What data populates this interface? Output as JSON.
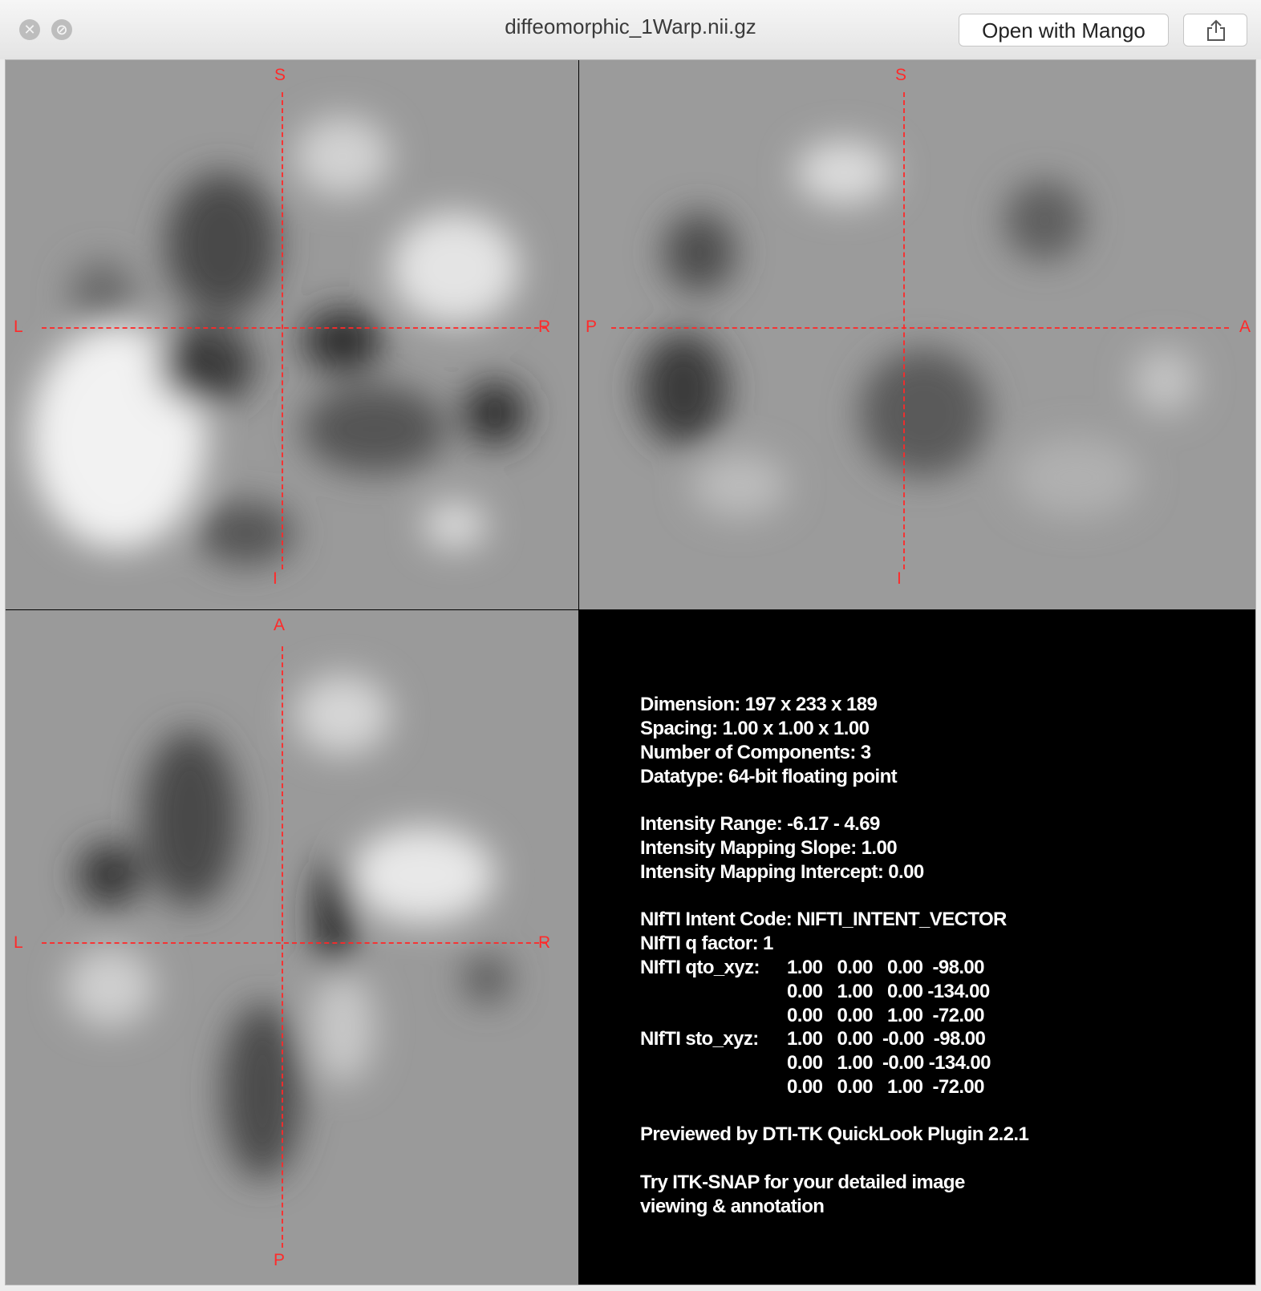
{
  "window": {
    "title": "diffeomorphic_1Warp.nii.gz",
    "open_button": "Open with Mango",
    "close_icon": "close-icon",
    "minimize_icon": "disabled-icon",
    "share_icon": "share-icon"
  },
  "views": {
    "axial": {
      "top": "S",
      "bottom": "I",
      "left": "L",
      "right": "R"
    },
    "sagittal": {
      "top": "S",
      "bottom": "I",
      "left": "P",
      "right": "A"
    },
    "coronal": {
      "top": "A",
      "bottom": "P",
      "left": "L",
      "right": "R"
    }
  },
  "info": {
    "dimension": "Dimension: 197 x 233 x 189",
    "spacing": "Spacing: 1.00 x 1.00 x 1.00",
    "components": "Number of Components: 3",
    "datatype": "Datatype: 64-bit floating point",
    "intensity_range": "Intensity Range: -6.17 - 4.69",
    "mapping_slope": "Intensity Mapping Slope: 1.00",
    "mapping_intercept": "Intensity Mapping Intercept: 0.00",
    "intent_code": "NIfTI Intent Code: NIFTI_INTENT_VECTOR",
    "q_factor": "NIfTI q factor:   1",
    "qto_label": "NIfTI qto_xyz:",
    "qto_rows": [
      "1.00   0.00   0.00  -98.00",
      "0.00   1.00   0.00 -134.00",
      "0.00   0.00   1.00  -72.00"
    ],
    "sto_label": "NIfTI sto_xyz:",
    "sto_rows": [
      "1.00   0.00  -0.00  -98.00",
      "0.00   1.00  -0.00 -134.00",
      "0.00   0.00   1.00  -72.00"
    ],
    "previewed": "Previewed by DTI-TK QuickLook Plugin 2.2.1",
    "try_line1": "Try ITK-SNAP for your detailed image",
    "try_line2": "viewing & annotation"
  },
  "colors": {
    "crosshair": "#ff2a2a",
    "background_gray": "#999999",
    "info_background": "#000000"
  }
}
